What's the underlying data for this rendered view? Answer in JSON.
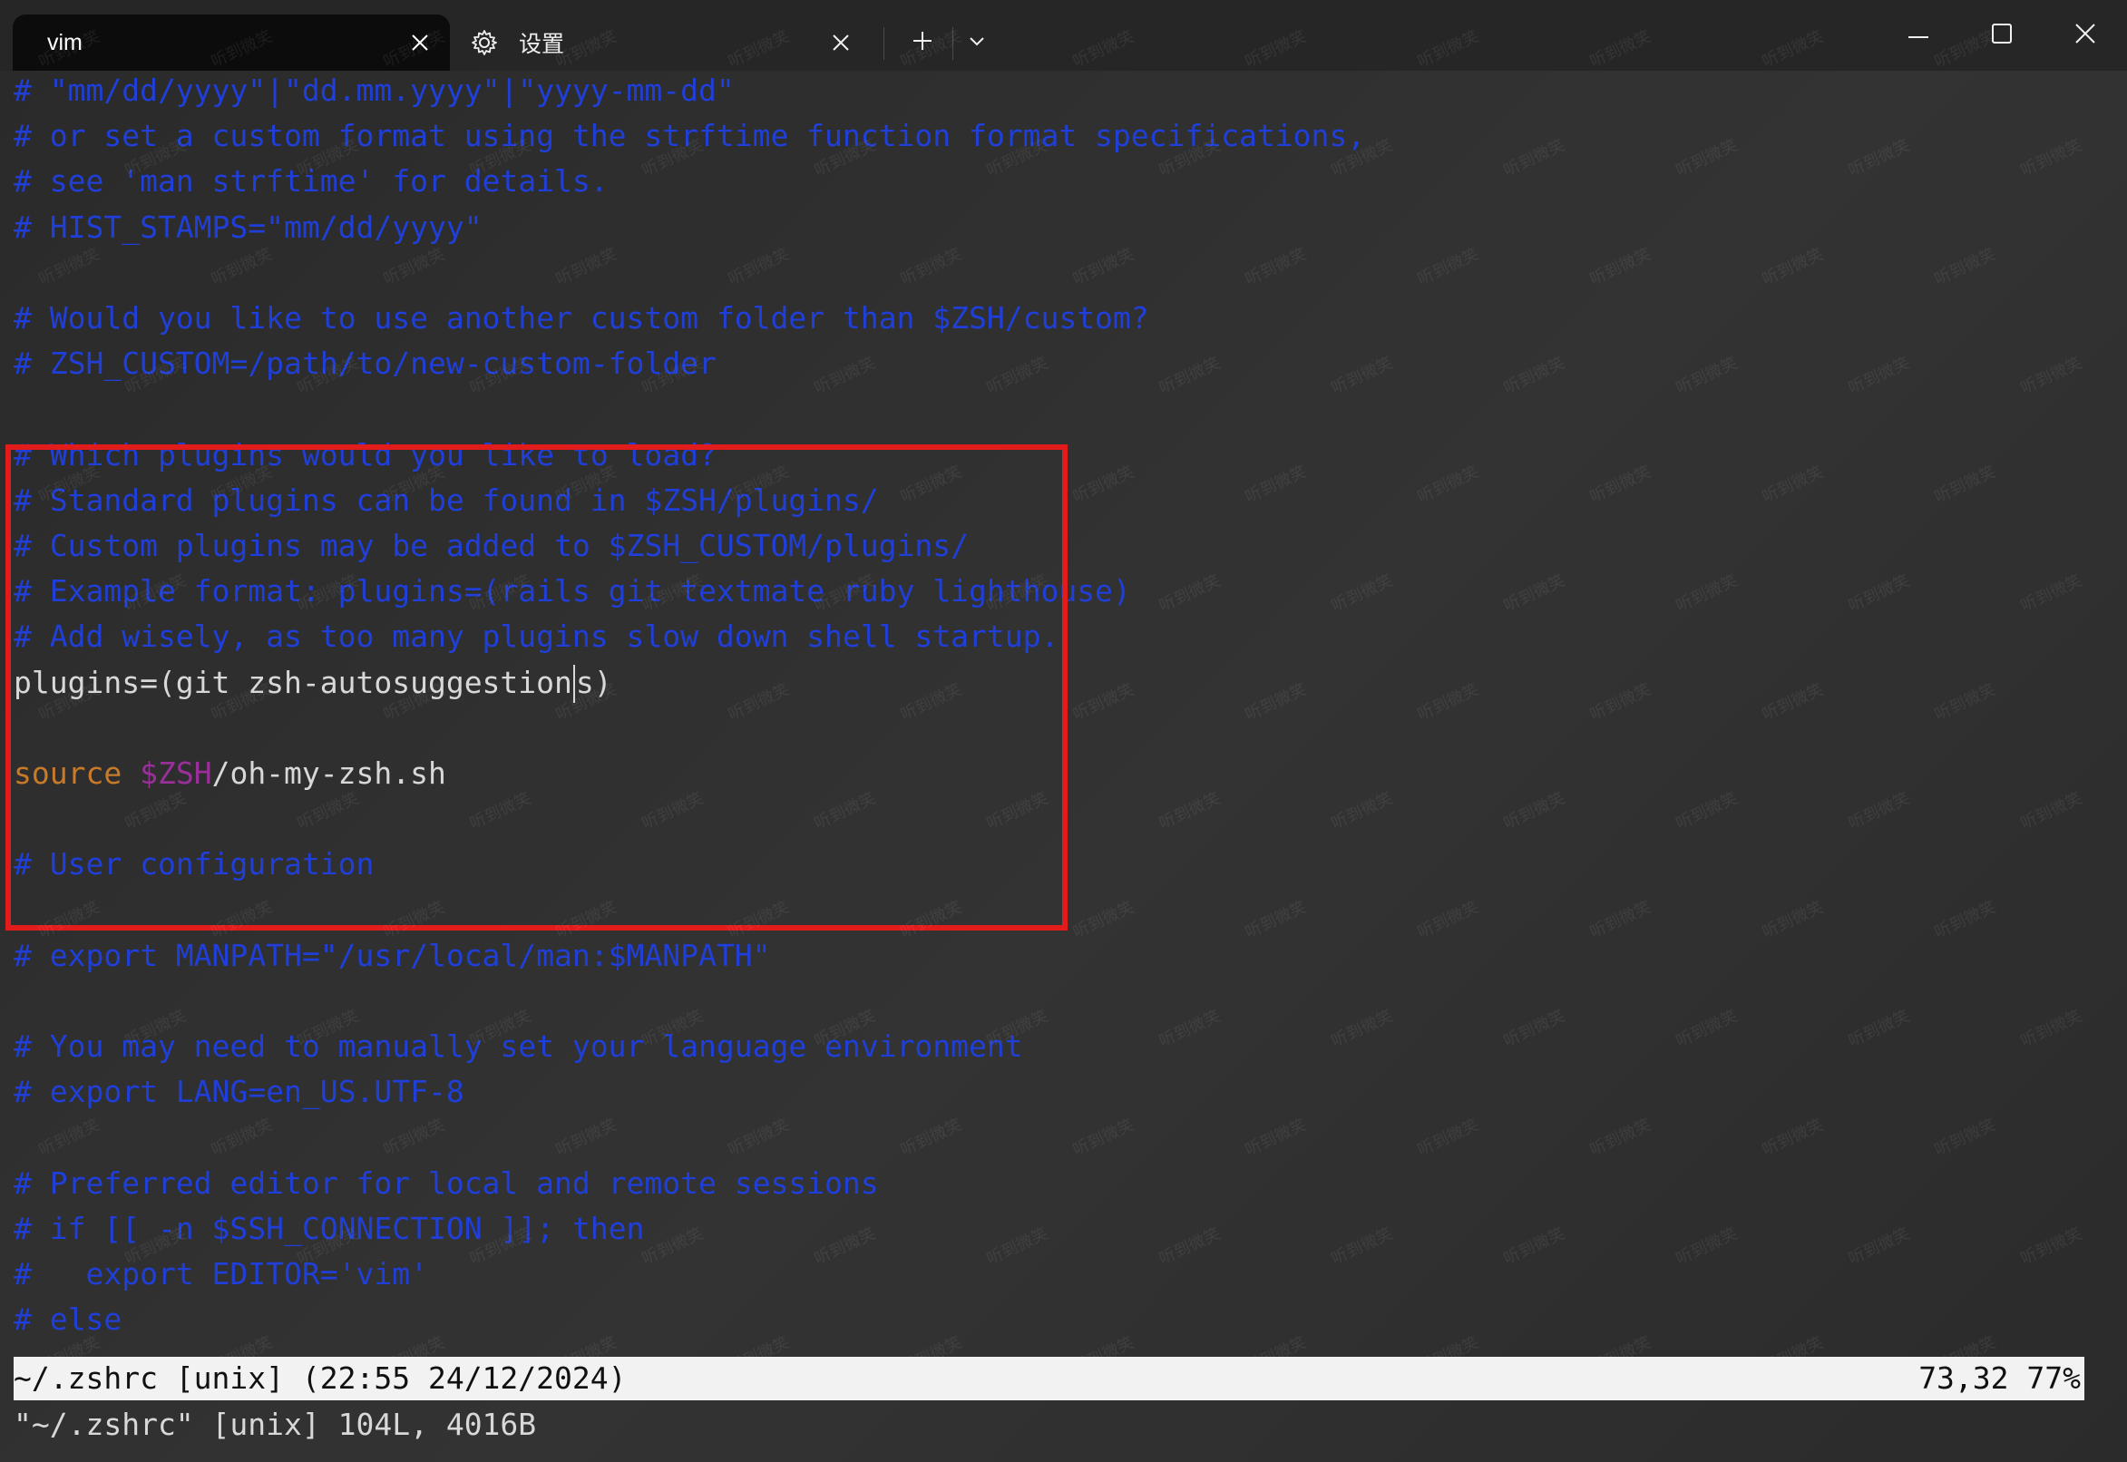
{
  "tabs": [
    {
      "label": "vim",
      "active": true
    },
    {
      "label": "设置",
      "active": false,
      "icon": "gear-icon"
    }
  ],
  "titlebar": {
    "new_tab_icon": "plus-icon",
    "dropdown_icon": "chevron-down-icon",
    "minimize_icon": "minimize-icon",
    "maximize_icon": "maximize-icon",
    "close_icon": "close-icon"
  },
  "editor": {
    "lines": [
      {
        "type": "comment",
        "text": "# \"mm/dd/yyyy\"|\"dd.mm.yyyy\"|\"yyyy-mm-dd\""
      },
      {
        "type": "comment",
        "text": "# or set a custom format using the strftime function format specifications,"
      },
      {
        "type": "comment",
        "text": "# see 'man strftime' for details."
      },
      {
        "type": "comment",
        "text": "# HIST_STAMPS=\"mm/dd/yyyy\""
      },
      {
        "type": "blank",
        "text": ""
      },
      {
        "type": "comment",
        "text": "# Would you like to use another custom folder than $ZSH/custom?"
      },
      {
        "type": "comment",
        "text": "# ZSH_CUSTOM=/path/to/new-custom-folder"
      },
      {
        "type": "blank",
        "text": ""
      },
      {
        "type": "comment",
        "text": "# Which plugins would you like to load?"
      },
      {
        "type": "comment",
        "text": "# Standard plugins can be found in $ZSH/plugins/"
      },
      {
        "type": "comment",
        "text": "# Custom plugins may be added to $ZSH_CUSTOM/plugins/"
      },
      {
        "type": "comment",
        "text": "# Example format: plugins=(rails git textmate ruby lighthouse)"
      },
      {
        "type": "comment",
        "text": "# Add wisely, as too many plugins slow down shell startup."
      },
      {
        "type": "code",
        "before_cursor": "plugins=(git zsh-autosuggestion",
        "after_cursor": "s)"
      },
      {
        "type": "blank",
        "text": ""
      },
      {
        "type": "source",
        "keyword": "source",
        "var": "$ZSH",
        "rest": "/oh-my-zsh.sh"
      },
      {
        "type": "blank",
        "text": ""
      },
      {
        "type": "comment",
        "text": "# User configuration"
      },
      {
        "type": "blank",
        "text": ""
      },
      {
        "type": "comment",
        "text": "# export MANPATH=\"/usr/local/man:$MANPATH\""
      },
      {
        "type": "blank",
        "text": ""
      },
      {
        "type": "comment",
        "text": "# You may need to manually set your language environment"
      },
      {
        "type": "comment",
        "text": "# export LANG=en_US.UTF-8"
      },
      {
        "type": "blank",
        "text": ""
      },
      {
        "type": "comment",
        "text": "# Preferred editor for local and remote sessions"
      },
      {
        "type": "comment",
        "text": "# if [[ -n $SSH_CONNECTION ]]; then"
      },
      {
        "type": "comment",
        "text": "#   export EDITOR='vim'"
      },
      {
        "type": "comment",
        "text": "# else"
      }
    ]
  },
  "statusline": {
    "left": "~/.zshrc [unix] (22:55 24/12/2024)",
    "right": "73,32 77%"
  },
  "message": "\"~/.zshrc\" [unix] 104L, 4016B",
  "watermark": "听到微笑",
  "colors": {
    "comment": "#1f3fd8",
    "source_keyword": "#c87a28",
    "variable": "#9a2f9a",
    "highlight_border": "#e21b1b"
  }
}
